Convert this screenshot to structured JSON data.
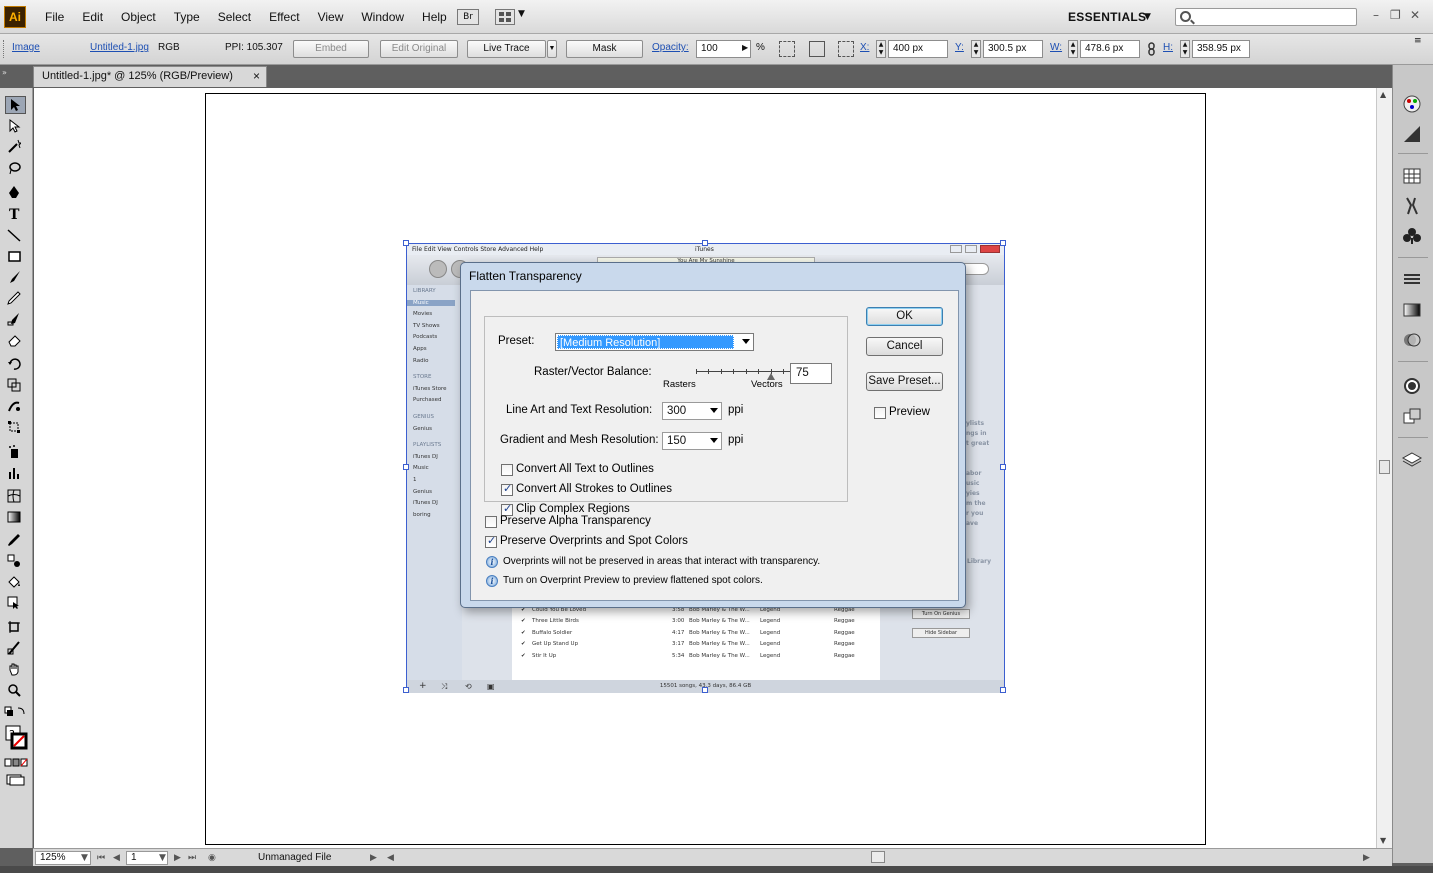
{
  "app": {
    "logo": "Ai"
  },
  "menu": [
    "File",
    "Edit",
    "Object",
    "Type",
    "Select",
    "Effect",
    "View",
    "Window",
    "Help"
  ],
  "menubar": {
    "bridge_label": "Br",
    "workspace": "ESSENTIALS",
    "search_placeholder": ""
  },
  "control_bar": {
    "type_label": "Image",
    "file_link": "Untitled-1.jpg",
    "color_mode": "RGB",
    "ppi": "PPI: 105.307",
    "embed": "Embed",
    "edit_original": "Edit Original",
    "live_trace": "Live Trace",
    "mask": "Mask",
    "opacity_label": "Opacity:",
    "opacity_value": "100",
    "percent": "%",
    "x_label": "X:",
    "x_value": "400 px",
    "y_label": "Y:",
    "y_value": "300.5 px",
    "w_label": "W:",
    "w_value": "478.6 px",
    "h_label": "H:",
    "h_value": "358.95 px"
  },
  "document_tab": {
    "title": "Untitled-1.jpg* @ 125% (RGB/Preview)",
    "close": "×"
  },
  "placed_image": {
    "titlebar": "File  Edit  View  Controls  Store  Advanced  Help",
    "window_title": "iTunes",
    "now_playing": "You Are My Sunshine",
    "sidebar": [
      {
        "label": "LIBRARY",
        "hdr": true
      },
      {
        "label": "Music",
        "active": true
      },
      {
        "label": "Movies"
      },
      {
        "label": "TV Shows"
      },
      {
        "label": "Podcasts"
      },
      {
        "label": "Apps"
      },
      {
        "label": "Radio"
      },
      {
        "label": "STORE",
        "hdr": true
      },
      {
        "label": "iTunes Store"
      },
      {
        "label": "Purchased"
      },
      {
        "label": "GENIUS",
        "hdr": true
      },
      {
        "label": "Genius"
      },
      {
        "label": "PLAYLISTS",
        "hdr": true
      },
      {
        "label": "iTunes DJ"
      },
      {
        "label": "Music"
      },
      {
        "label": "1"
      },
      {
        "label": "Genius"
      },
      {
        "label": "iTunes DJ"
      },
      {
        "label": "boring"
      }
    ],
    "songs": [
      {
        "name": "Could You Be Loved",
        "time": "3:58",
        "artist": "Bob Marley & The W...",
        "album": "Legend",
        "genre": "Reggae"
      },
      {
        "name": "Three Little Birds",
        "time": "3:00",
        "artist": "Bob Marley & The W...",
        "album": "Legend",
        "genre": "Reggae"
      },
      {
        "name": "Buffalo Soldier",
        "time": "4:17",
        "artist": "Bob Marley & The W...",
        "album": "Legend",
        "genre": "Reggae"
      },
      {
        "name": "Get Up Stand Up",
        "time": "3:17",
        "artist": "Bob Marley & The W...",
        "album": "Legend",
        "genre": "Reggae"
      },
      {
        "name": "Stir It Up",
        "time": "5:34",
        "artist": "Bob Marley & The W...",
        "album": "Legend",
        "genre": "Reggae"
      }
    ],
    "status": "15501 songs, 43.3 days, 86.4 GB",
    "genius_on": "Turn On Genius",
    "hide_sidebar": "Hide Sidebar",
    "right_text": [
      "ylists",
      "ngs in",
      "t great",
      "abor",
      "usic",
      "yies",
      "m the",
      "r you",
      "ave",
      "Library"
    ]
  },
  "dialog": {
    "title": "Flatten Transparency",
    "preset_label": "Preset:",
    "preset_value": "[Medium Resolution]",
    "balance_label": "Raster/Vector Balance:",
    "rasters": "Rasters",
    "vectors": "Vectors",
    "balance_value": "75",
    "balance_fraction": 0.75,
    "lineart_label": "Line Art and Text Resolution:",
    "lineart_value": "300",
    "gradient_label": "Gradient and Mesh Resolution:",
    "gradient_value": "150",
    "ppi": "ppi",
    "text_outlines": "Convert All Text to Outlines",
    "strokes_outlines": "Convert All Strokes to Outlines",
    "clip_complex": "Clip Complex Regions",
    "preserve_alpha": "Preserve Alpha Transparency",
    "preserve_overprints": "Preserve Overprints and Spot Colors",
    "info1": "Overprints will not be preserved in areas that interact with transparency.",
    "info2": "Turn on Overprint Preview to preview flattened spot colors.",
    "ok": "OK",
    "cancel": "Cancel",
    "save_preset": "Save Preset...",
    "preview": "Preview"
  },
  "status_bar": {
    "zoom": "125%",
    "page": "1",
    "file_status": "Unmanaged File"
  },
  "colors": {
    "selection": "#3c5fd0",
    "preset_highlight": "#3399ff",
    "link": "#1d4fb3"
  }
}
